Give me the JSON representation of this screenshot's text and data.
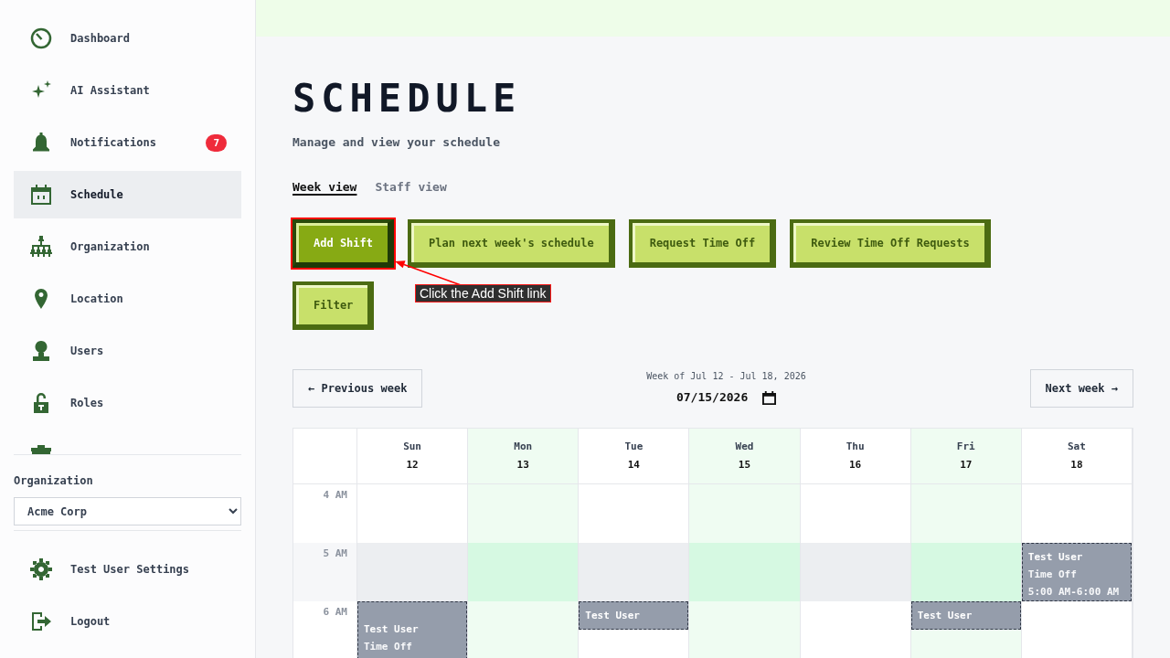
{
  "sidebar": {
    "items": [
      {
        "label": "Dashboard",
        "selected": false
      },
      {
        "label": "AI Assistant",
        "selected": false
      },
      {
        "label": "Notifications",
        "badge": "7",
        "selected": false
      },
      {
        "label": "Schedule",
        "selected": true
      },
      {
        "label": "Organization",
        "selected": false
      },
      {
        "label": "Location",
        "selected": false
      },
      {
        "label": "Users",
        "selected": false
      },
      {
        "label": "Roles",
        "selected": false
      },
      {
        "selected": false
      }
    ],
    "organization": {
      "label": "Organization",
      "value": "Acme Corp"
    },
    "footer_items": [
      {
        "label": "Test User Settings"
      },
      {
        "label": "Logout"
      }
    ]
  },
  "page": {
    "title": "SCHEDULE",
    "subtitle": "Manage and view your schedule"
  },
  "tabs": [
    {
      "label": "Week view",
      "selected": true
    },
    {
      "label": "Staff view",
      "selected": false
    }
  ],
  "actions": [
    {
      "label": "Add Shift",
      "kind": "primary",
      "annotated": true
    },
    {
      "label": "Plan next week's schedule",
      "kind": "secondary",
      "annotated": false
    },
    {
      "label": "Request Time Off",
      "kind": "secondary",
      "annotated": false
    },
    {
      "label": "Review Time Off Requests",
      "kind": "secondary",
      "annotated": false
    }
  ],
  "filter_button": {
    "label": "Filter"
  },
  "annotation": {
    "text": "Click the Add Shift link"
  },
  "week_nav": {
    "previous": "← Previous week",
    "range": "Week of Jul 12 - Jul 18, 2026",
    "date": "07/15/2026",
    "next": "Next week →"
  },
  "calendar": {
    "days": [
      {
        "name": "Sun",
        "date": "12",
        "highlighted": false
      },
      {
        "name": "Mon",
        "date": "13",
        "highlighted": true
      },
      {
        "name": "Tue",
        "date": "14",
        "highlighted": false
      },
      {
        "name": "Wed",
        "date": "15",
        "highlighted": true
      },
      {
        "name": "Thu",
        "date": "16",
        "highlighted": false
      },
      {
        "name": "Fri",
        "date": "17",
        "highlighted": true
      },
      {
        "name": "Sat",
        "date": "18",
        "highlighted": false
      }
    ],
    "hours": [
      {
        "label": "4 AM",
        "shaded": false,
        "cells": [
          {
            "kind": "empty"
          },
          {
            "kind": "empty"
          },
          {
            "kind": "empty"
          },
          {
            "kind": "empty"
          },
          {
            "kind": "empty"
          },
          {
            "kind": "empty"
          },
          {
            "kind": "empty"
          }
        ]
      },
      {
        "label": "5 AM",
        "shaded": true,
        "cells": [
          {
            "kind": "empty"
          },
          {
            "kind": "empty"
          },
          {
            "kind": "empty"
          },
          {
            "kind": "empty"
          },
          {
            "kind": "empty"
          },
          {
            "kind": "empty"
          },
          {
            "kind": "time_off",
            "title": "Test User",
            "type": "Time Off",
            "time": "5:00 AM-6:00 AM",
            "continues": false
          }
        ]
      },
      {
        "label": "6 AM",
        "shaded": false,
        "cells": [
          {
            "kind": "time_off",
            "title": "Test User",
            "type": "Time Off",
            "continues": true
          },
          {
            "kind": "empty"
          },
          {
            "kind": "shift",
            "title": "Test User"
          },
          {
            "kind": "empty"
          },
          {
            "kind": "empty"
          },
          {
            "kind": "shift",
            "title": "Test User"
          },
          {
            "kind": "empty"
          }
        ]
      }
    ]
  }
}
